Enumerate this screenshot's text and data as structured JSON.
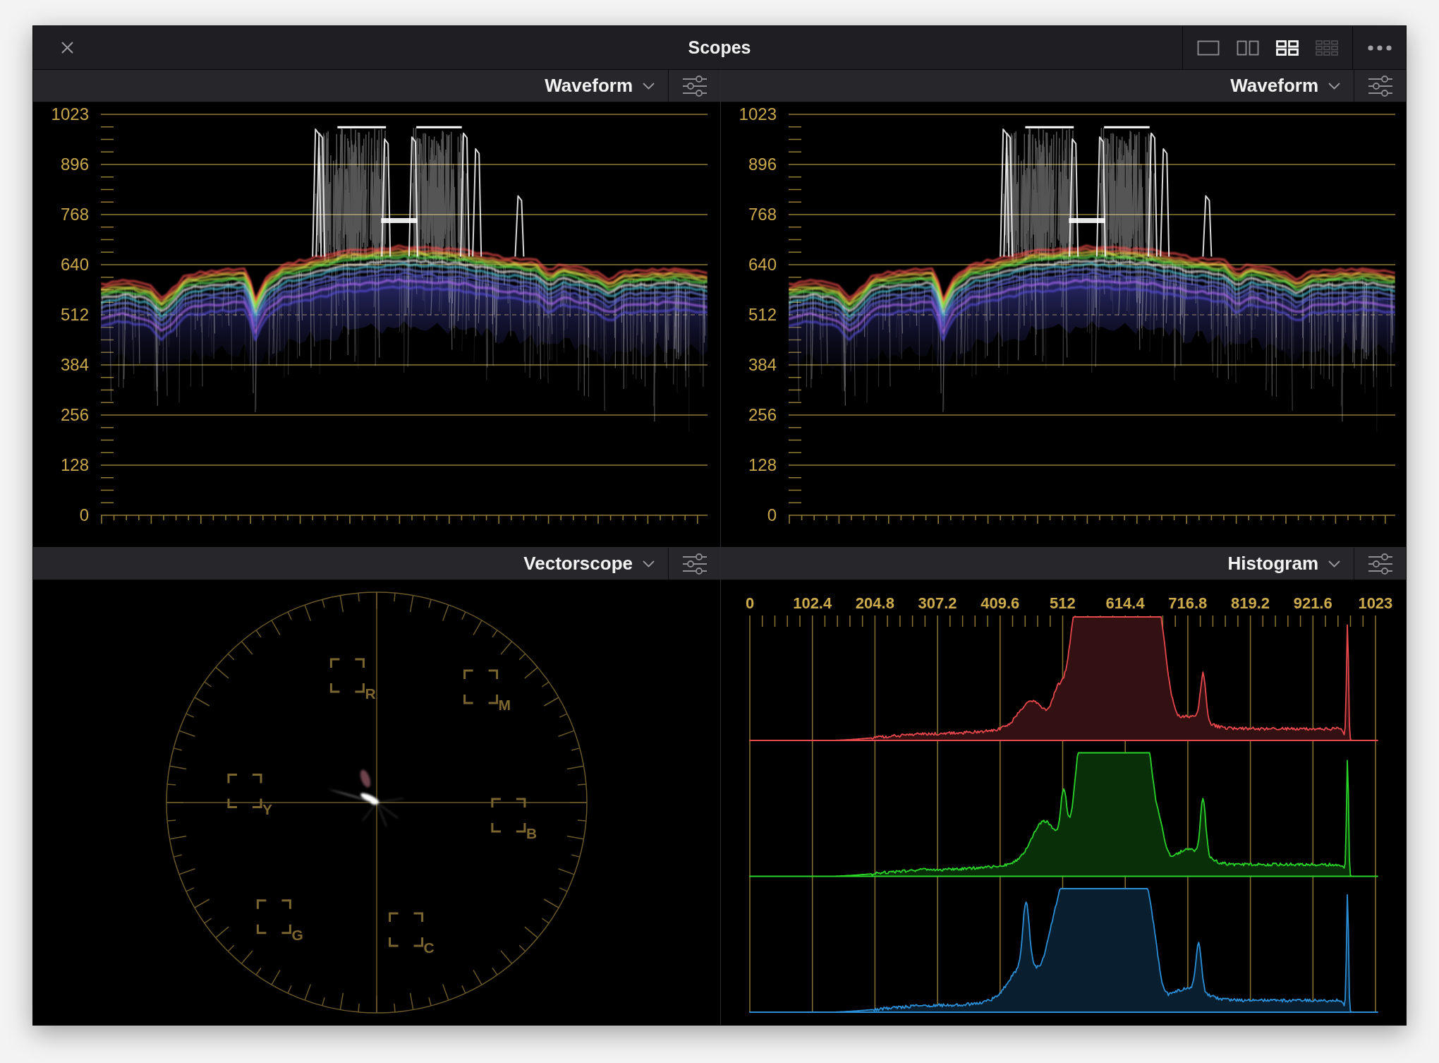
{
  "window": {
    "title": "Scopes"
  },
  "layouts": [
    {
      "kind": "single",
      "selected": false,
      "disabled": false
    },
    {
      "kind": "dual",
      "selected": false,
      "disabled": false
    },
    {
      "kind": "quad",
      "selected": true,
      "disabled": false
    },
    {
      "kind": "grid",
      "selected": false,
      "disabled": true
    }
  ],
  "panels": [
    {
      "kind": "waveform",
      "title": "Waveform",
      "scale_labels": [
        "1023",
        "896",
        "768",
        "640",
        "512",
        "384",
        "256",
        "128",
        "0"
      ]
    },
    {
      "kind": "waveform",
      "title": "Waveform",
      "scale_labels": [
        "1023",
        "896",
        "768",
        "640",
        "512",
        "384",
        "256",
        "128",
        "0"
      ]
    },
    {
      "kind": "vectorscope",
      "title": "Vectorscope",
      "targets": [
        "R",
        "M",
        "B",
        "C",
        "G",
        "Y"
      ]
    },
    {
      "kind": "histogram",
      "title": "Histogram",
      "scale_labels": [
        "0",
        "102.4",
        "204.8",
        "307.2",
        "409.6",
        "512",
        "614.4",
        "716.8",
        "819.2",
        "921.6",
        "1023"
      ],
      "channels": [
        {
          "color": "#e8474c"
        },
        {
          "color": "#2ad52a"
        },
        {
          "color": "#2b8fd8"
        }
      ]
    }
  ]
}
